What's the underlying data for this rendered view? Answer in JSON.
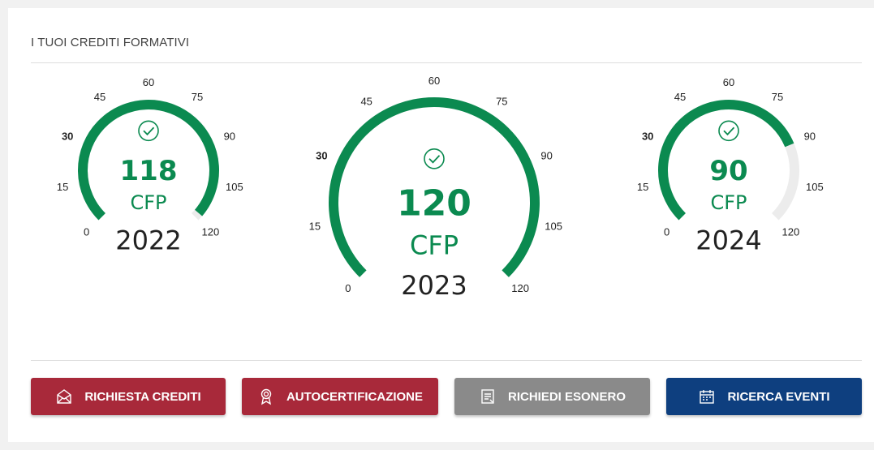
{
  "section": {
    "title": "I TUOI CREDITI FORMATIVI"
  },
  "colors": {
    "accent": "#0b8a50",
    "track": "#ececec",
    "red": "#a8293a",
    "grey": "#8a8a8a",
    "blue": "#0e3f7f"
  },
  "gauges": [
    {
      "year": "2022",
      "value": 118,
      "value_label": "118",
      "unit": "CFP",
      "max": 120,
      "check_icon": "check-circle-icon",
      "ticks": [
        "0",
        "15",
        "30",
        "45",
        "60",
        "75",
        "90",
        "105",
        "120"
      ]
    },
    {
      "year": "2023",
      "value": 120,
      "value_label": "120",
      "unit": "CFP",
      "max": 120,
      "check_icon": "check-circle-icon",
      "ticks": [
        "0",
        "15",
        "30",
        "45",
        "60",
        "75",
        "90",
        "105",
        "120"
      ]
    },
    {
      "year": "2024",
      "value": 90,
      "value_label": "90",
      "unit": "CFP",
      "max": 120,
      "check_icon": "check-circle-icon",
      "ticks": [
        "0",
        "15",
        "30",
        "45",
        "60",
        "75",
        "90",
        "105",
        "120"
      ]
    }
  ],
  "buttons": [
    {
      "label": "RICHIESTA CREDITI",
      "icon": "mail-icon"
    },
    {
      "label": "AUTOCERTIFICAZIONE",
      "icon": "award-icon"
    },
    {
      "label": "RICHIEDI ESONERO",
      "icon": "document-icon"
    },
    {
      "label": "RICERCA EVENTI",
      "icon": "calendar-icon"
    }
  ]
}
